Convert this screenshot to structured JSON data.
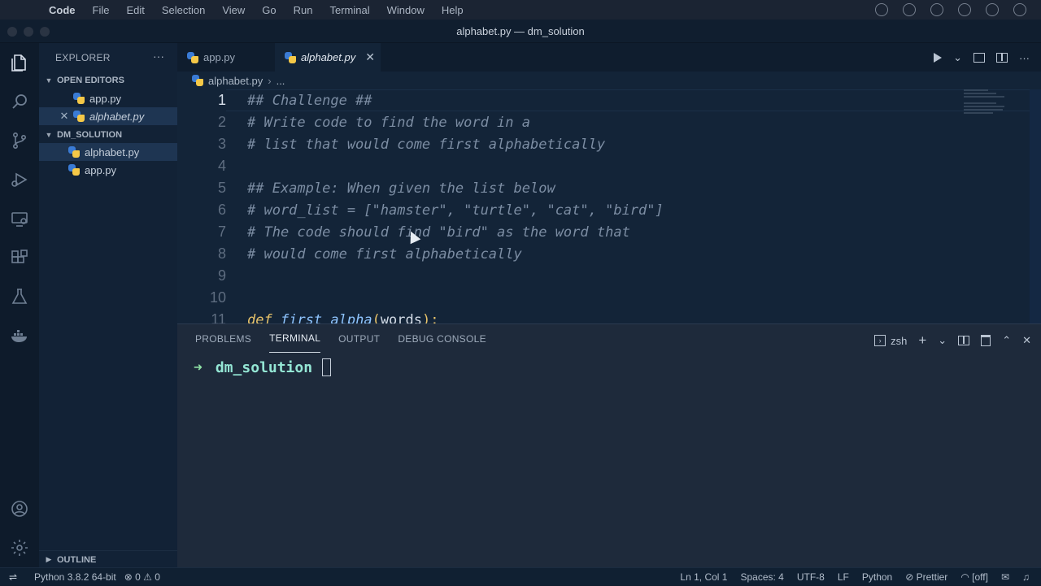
{
  "menubar": {
    "app_name": "Code",
    "items": [
      "File",
      "Edit",
      "Selection",
      "View",
      "Go",
      "Run",
      "Terminal",
      "Window",
      "Help"
    ]
  },
  "window": {
    "title": "alphabet.py — dm_solution"
  },
  "sidebar": {
    "header": "EXPLORER",
    "more": "···",
    "open_editors_title": "OPEN EDITORS",
    "open_editors": [
      {
        "name": "app.py",
        "italic": false
      },
      {
        "name": "alphabet.py",
        "italic": true
      }
    ],
    "folder_title": "DM_SOLUTION",
    "folder_files": [
      {
        "name": "alphabet.py"
      },
      {
        "name": "app.py"
      }
    ],
    "outline_title": "OUTLINE"
  },
  "tabs": {
    "inactive": "app.py",
    "active": "alphabet.py"
  },
  "breadcrumb": {
    "file": "alphabet.py",
    "rest": "..."
  },
  "code_lines": [
    {
      "n": "1",
      "text": "## Challenge ##"
    },
    {
      "n": "2",
      "text": "# Write code to find the word in a"
    },
    {
      "n": "3",
      "text": "# list that would come first alphabetically"
    },
    {
      "n": "4",
      "text": ""
    },
    {
      "n": "5",
      "text": "## Example: When given the list below"
    },
    {
      "n": "6",
      "text": "# word_list = [\"hamster\", \"turtle\", \"cat\", \"bird\"]"
    },
    {
      "n": "7",
      "text": "# The code should find \"bird\" as the word that"
    },
    {
      "n": "8",
      "text": "# would come first alphabetically"
    },
    {
      "n": "9",
      "text": ""
    },
    {
      "n": "10",
      "text": ""
    },
    {
      "n": "11",
      "kw": "def",
      "fn": "first_alpha",
      "open": "(",
      "args": "words",
      "close": "):"
    }
  ],
  "panel": {
    "tabs": [
      "PROBLEMS",
      "TERMINAL",
      "OUTPUT",
      "DEBUG CONSOLE"
    ],
    "active_tab": "TERMINAL",
    "shell": "zsh",
    "prompt_arrow": "➜",
    "prompt_dir": "dm_solution"
  },
  "statusbar": {
    "python": "Python 3.8.2 64-bit",
    "errors": "0",
    "warnings": "0",
    "position": "Ln 1, Col 1",
    "spaces": "Spaces: 4",
    "encoding": "UTF-8",
    "eol": "LF",
    "language": "Python",
    "prettier": "Prettier",
    "off": "[off]"
  }
}
